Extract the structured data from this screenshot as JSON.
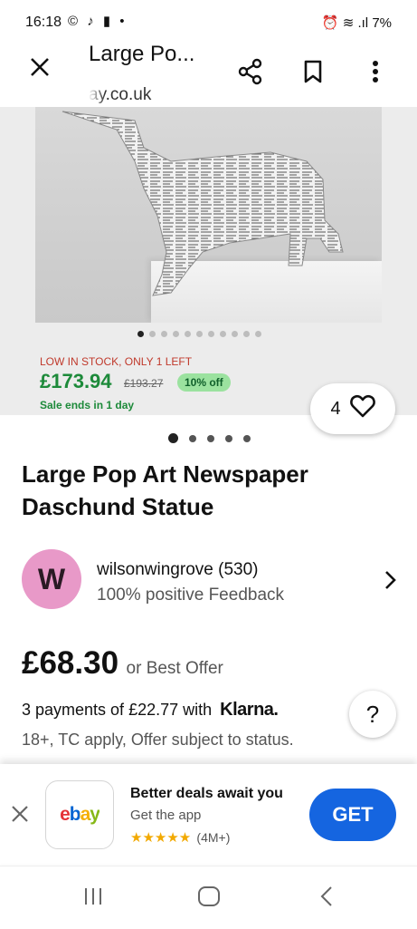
{
  "status_bar": {
    "time": "16:18",
    "battery": "7%",
    "left_icons": "© ♪ ▮ •",
    "right_icons": "⏰ ≋ .ıl"
  },
  "toolbar": {
    "title": "Large Po...",
    "url": "ay.co.uk"
  },
  "image_gallery": {
    "dot_count": 11,
    "active_index": 0
  },
  "promo": {
    "stock_text": "LOW IN STOCK, ONLY 1 LEFT",
    "price": "£173.94",
    "old_price": "£193.27",
    "discount": "10% off",
    "sale_ends": "Sale ends in 1 day"
  },
  "watch": {
    "count": "4"
  },
  "page_dots": {
    "count": 5,
    "active_index": 0
  },
  "product": {
    "title": "Large Pop Art Newspaper Daschund Statue"
  },
  "seller": {
    "initial": "W",
    "name": "wilsonwingrove (530)",
    "feedback": "100% positive Feedback"
  },
  "pricing": {
    "price": "£68.30",
    "best_offer": "or Best Offer",
    "klarna_text": "3 payments of £22.77 with",
    "klarna_brand": "Klarna.",
    "klarna_terms": "18+, TC apply, Offer subject to status.",
    "help": "?"
  },
  "app_banner": {
    "logo_text": "ebay",
    "title": "Better deals await you",
    "subtitle": "Get the app",
    "stars": "★★★★★",
    "rating_count": "(4M+)",
    "get_label": "GET"
  },
  "colors": {
    "accent_blue": "#1565e0",
    "price_green": "#1d8a3a",
    "stock_red": "#c0392b",
    "avatar_pink": "#e899c8"
  }
}
